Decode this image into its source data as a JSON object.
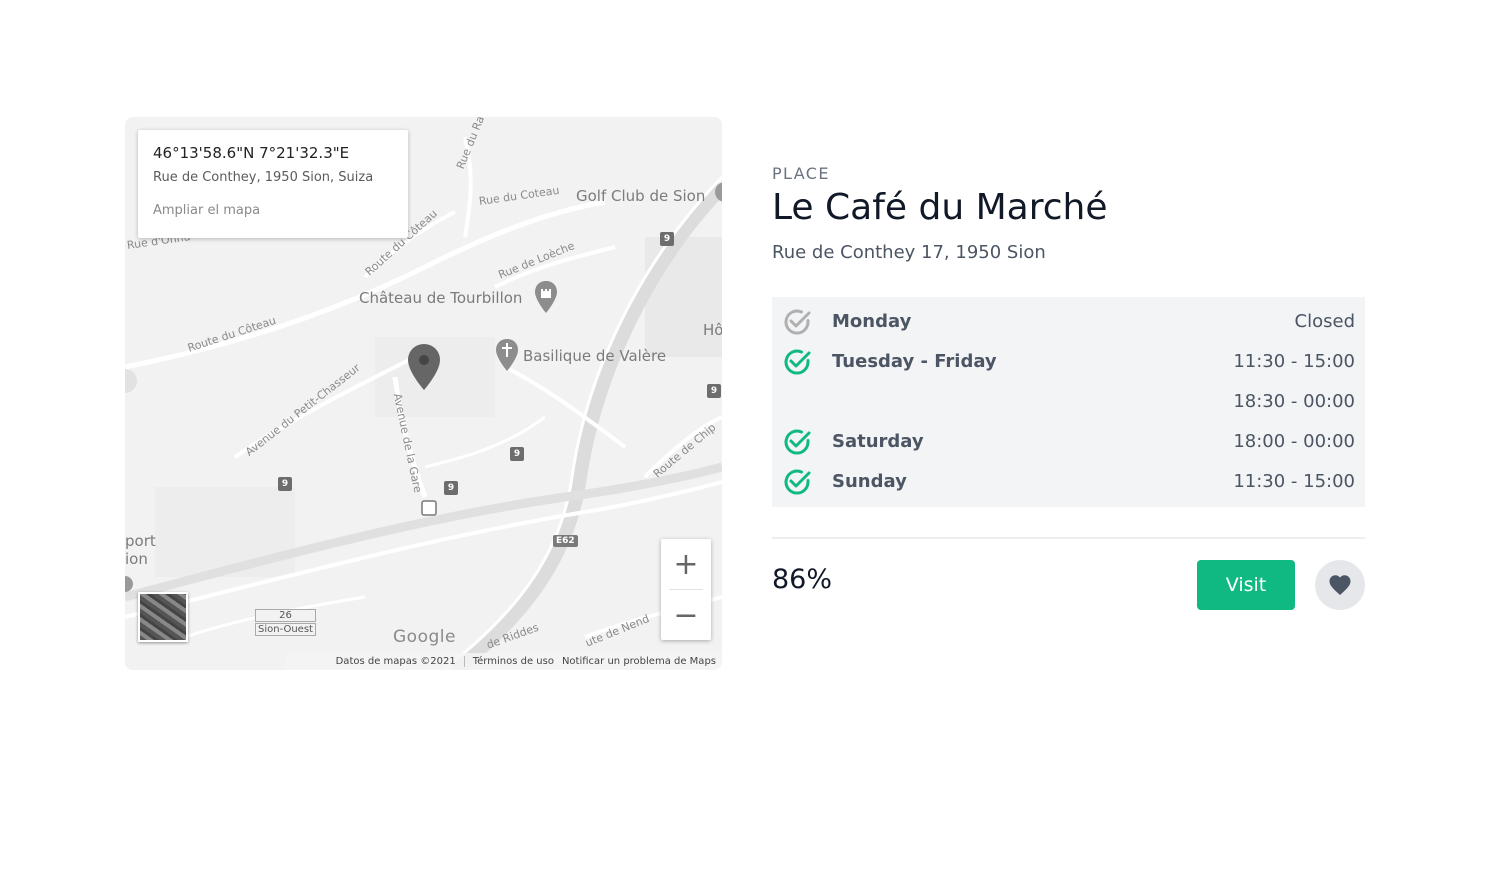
{
  "map": {
    "coords": "46°13'58.6\"N 7°21'32.3\"E",
    "address": "Rue de Conthey, 1950 Sion, Suiza",
    "enlarge_label": "Ampliar el mapa",
    "street_labels": [
      "Rue du Rawil",
      "Rue du Coteau",
      "Route du Côteau",
      "Rue de Loèche",
      "Route du Côteau",
      "Avenue du Petit-Chasseur",
      "Avenue de la Gare",
      "Route de Chip",
      "de Riddes",
      "ute de Nend",
      "Rue d'Onnu",
      "Hô"
    ],
    "poi_labels": [
      "Golf Club de Sion",
      "Château de Tourbillon",
      "Basilique de Valère"
    ],
    "edge_labels": [
      "port",
      "ion"
    ],
    "place_labels": [
      "26",
      "Sion-Ouest"
    ],
    "road_shields": [
      "9",
      "9",
      "9",
      "9",
      "9"
    ],
    "highway_label": "E62",
    "zoom_in": "+",
    "zoom_out": "−",
    "logo": "Google",
    "footer": [
      "Datos de mapas ©2021",
      "Términos de uso",
      "Notificar un problema de Maps"
    ]
  },
  "place": {
    "kicker": "PLACE",
    "name": "Le Café du Marché",
    "address": "Rue de Conthey 17, 1950 Sion"
  },
  "hours": [
    {
      "day": "Monday",
      "time": "Closed",
      "open": false,
      "icon": "check-circle-icon"
    },
    {
      "day": "Tuesday - Friday",
      "time": "11:30 - 15:00",
      "open": true,
      "icon": "check-circle-icon"
    },
    {
      "day": "",
      "time": "18:30 - 00:00",
      "open": true,
      "icon": ""
    },
    {
      "day": "Saturday",
      "time": "18:00 - 00:00",
      "open": true,
      "icon": "check-circle-icon"
    },
    {
      "day": "Sunday",
      "time": "11:30 - 15:00",
      "open": true,
      "icon": "check-circle-icon"
    }
  ],
  "rating": "86%",
  "actions": {
    "visit_label": "Visit",
    "favorite_icon": "heart-icon"
  },
  "colors": {
    "accent": "#10b981",
    "closed_check": "#b0b0b0",
    "hours_bg": "#f3f4f6"
  }
}
